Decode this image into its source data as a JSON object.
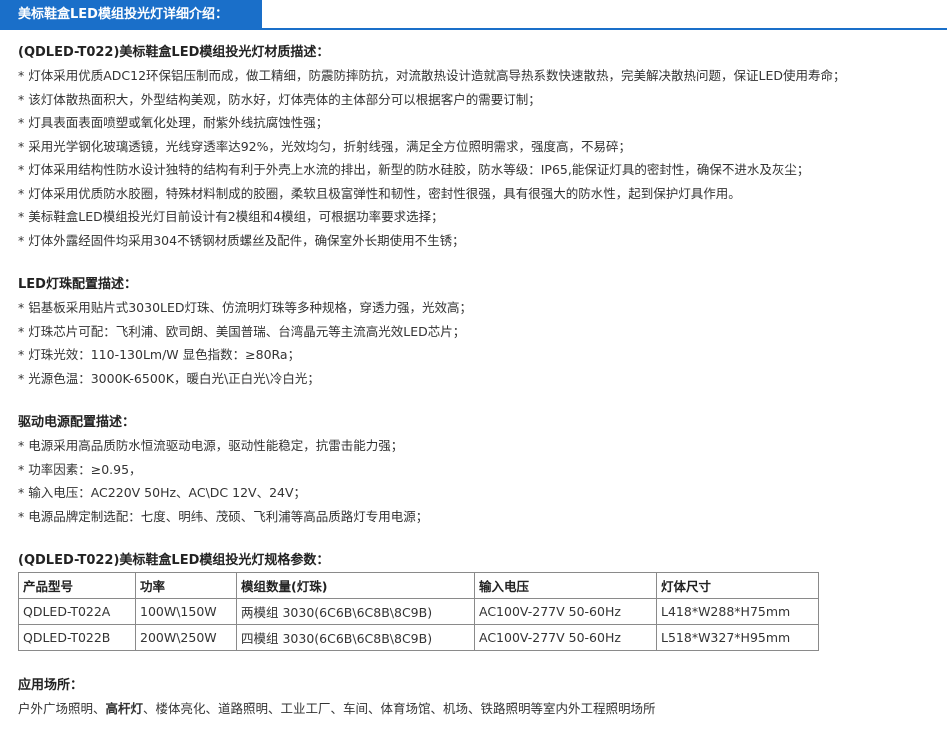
{
  "tab": {
    "title": "美标鞋盒LED模组投光灯详细介绍："
  },
  "material": {
    "title": "(QDLED-T022)美标鞋盒LED模组投光灯材质描述：",
    "lines": [
      "* 灯体采用优质ADC12环保铝压制而成，做工精细，防震防摔防抗，对流散热设计造就高导热系数快速散热，完美解决散热问题，保证LED使用寿命；",
      "* 该灯体散热面积大，外型结构美观，防水好，灯体壳体的主体部分可以根据客户的需要订制；",
      "* 灯具表面表面喷塑或氧化处理，耐紫外线抗腐蚀性强；",
      "* 采用光学钢化玻璃透镜，光线穿透率达92%，光效均匀，折射线强，满足全方位照明需求，强度高，不易碎；",
      "* 灯体采用结构性防水设计独特的结构有利于外壳上水流的排出，新型的防水硅胶，防水等级：IP65,能保证灯具的密封性，确保不进水及灰尘；",
      "* 灯体采用优质防水胶圈，特殊材料制成的胶圈，柔软且极富弹性和韧性，密封性很强，具有很强大的防水性，起到保护灯具作用。",
      "* 美标鞋盒LED模组投光灯目前设计有2模组和4模组，可根据功率要求选择；",
      "* 灯体外露经固件均采用304不锈钢材质螺丝及配件，确保室外长期使用不生锈；"
    ]
  },
  "led": {
    "title": "LED灯珠配置描述：",
    "lines": [
      "* 铝基板采用贴片式3030LED灯珠、仿流明灯珠等多种规格，穿透力强，光效高；",
      "* 灯珠芯片可配：飞利浦、欧司朗、美国普瑞、台湾晶元等主流高光效LED芯片；",
      "* 灯珠光效：110-130Lm/W 显色指数：≥80Ra；",
      "* 光源色温：3000K-6500K，暖白光\\正白光\\冷白光；"
    ]
  },
  "driver": {
    "title": "驱动电源配置描述：",
    "lines": [
      "* 电源采用高品质防水恒流驱动电源，驱动性能稳定，抗雷击能力强；",
      "* 功率因素：≥0.95，",
      "* 输入电压：AC220V 50Hz、AC\\DC 12V、24V；",
      "* 电源品牌定制选配：七度、明纬、茂硕、飞利浦等高品质路灯专用电源；"
    ]
  },
  "spec": {
    "title": "(QDLED-T022)美标鞋盒LED模组投光灯规格参数：",
    "headers": [
      "产品型号",
      "功率",
      "模组数量(灯珠)",
      "输入电压",
      "灯体尺寸"
    ],
    "rows": [
      [
        "QDLED-T022A",
        "100W\\150W",
        "两模组 3030(6C6B\\6C8B\\8C9B)",
        "AC100V-277V 50-60Hz",
        "L418*W288*H75mm"
      ],
      [
        "QDLED-T022B",
        "200W\\250W",
        "四模组 3030(6C6B\\6C8B\\8C9B)",
        "AC100V-277V 50-60Hz",
        "L518*W327*H95mm"
      ]
    ]
  },
  "application": {
    "title": "应用场所：",
    "text_before": "户外广场照明、",
    "bold": "高杆灯",
    "text_after": "、楼体亮化、道路照明、工业工厂、车间、体育场馆、机场、铁路照明等室内外工程照明场所"
  }
}
